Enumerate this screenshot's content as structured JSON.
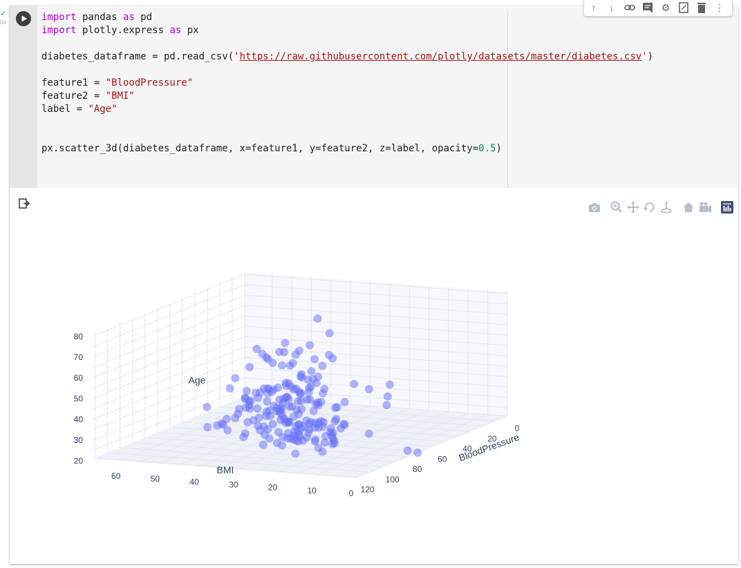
{
  "exec": {
    "check": "✓",
    "time": "0s"
  },
  "toolbar": {
    "icons": [
      "arrow-up-icon",
      "arrow-down-icon",
      "link-icon",
      "comment-icon",
      "gear-icon",
      "mirror-icon",
      "trash-icon",
      "more-icon"
    ]
  },
  "code": {
    "l1": {
      "kw": "import",
      "text": " pandas ",
      "kw2": "as",
      "text2": " pd"
    },
    "l2": {
      "kw": "import",
      "text": " plotly.express ",
      "kw2": "as",
      "text2": " px"
    },
    "l4": {
      "a": "diabetes_dataframe = pd.read_csv(",
      "q1": "'",
      "url": "https://raw.githubusercontent.com/plotly/datasets/master/diabetes.csv",
      "q2": "'",
      "b": ")"
    },
    "l6": {
      "a": "feature1 = ",
      "s": "\"BloodPressure\""
    },
    "l7": {
      "a": "feature2 = ",
      "s": "\"BMI\""
    },
    "l8": {
      "a": "label = ",
      "s": "\"Age\""
    },
    "l11": {
      "a": "px.scatter_3d(diabetes_dataframe, x=feature1, y=feature2, z=label, opacity=",
      "n": "0.5",
      "b": ")"
    }
  },
  "chart_data": {
    "type": "scatter",
    "projection": "3d",
    "marker_color": "#636efa",
    "opacity": 0.5,
    "axes": {
      "x": {
        "title": "BloodPressure",
        "ticks": [
          "0",
          "20",
          "40",
          "60",
          "80",
          "100",
          "120"
        ],
        "range": [
          0,
          122
        ]
      },
      "y": {
        "title": "BMI",
        "ticks": [
          "0",
          "10",
          "20",
          "30",
          "40",
          "50",
          "60"
        ],
        "range": [
          0,
          67
        ]
      },
      "z": {
        "title": "Age",
        "ticks": [
          "20",
          "30",
          "40",
          "50",
          "60",
          "70",
          "80"
        ],
        "range": [
          21,
          81
        ]
      }
    },
    "points": [
      [
        72,
        33.6,
        50
      ],
      [
        66,
        26.6,
        31
      ],
      [
        64,
        23.3,
        32
      ],
      [
        66,
        28.1,
        21
      ],
      [
        40,
        43.1,
        33
      ],
      [
        74,
        25.6,
        30
      ],
      [
        50,
        31,
        26
      ],
      [
        0,
        35.3,
        29
      ],
      [
        70,
        30.5,
        53
      ],
      [
        96,
        0,
        54
      ],
      [
        92,
        37.6,
        30
      ],
      [
        74,
        38,
        34
      ],
      [
        80,
        27.1,
        57
      ],
      [
        60,
        30.1,
        59
      ],
      [
        72,
        25.8,
        51
      ],
      [
        0,
        30,
        32
      ],
      [
        84,
        45.8,
        31
      ],
      [
        74,
        29.6,
        31
      ],
      [
        30,
        43.3,
        33
      ],
      [
        70,
        34.6,
        32
      ],
      [
        88,
        39.3,
        27
      ],
      [
        84,
        35.4,
        50
      ],
      [
        90,
        39.8,
        41
      ],
      [
        80,
        29,
        29
      ],
      [
        94,
        36.6,
        51
      ],
      [
        70,
        31.1,
        41
      ],
      [
        76,
        39.4,
        43
      ],
      [
        66,
        23.2,
        22
      ],
      [
        82,
        22.2,
        57
      ],
      [
        92,
        34.1,
        38
      ],
      [
        75,
        36,
        60
      ],
      [
        58,
        31.6,
        28
      ],
      [
        92,
        24.8,
        22
      ],
      [
        78,
        19.9,
        28
      ],
      [
        60,
        27.6,
        45
      ],
      [
        76,
        24,
        33
      ],
      [
        76,
        33.2,
        35
      ],
      [
        68,
        32.9,
        46
      ],
      [
        72,
        38.2,
        27
      ],
      [
        64,
        37.1,
        56
      ],
      [
        84,
        34,
        26
      ],
      [
        92,
        40.2,
        37
      ],
      [
        110,
        22.7,
        48
      ],
      [
        64,
        45.4,
        54
      ],
      [
        66,
        27.4,
        40
      ],
      [
        56,
        42,
        25
      ],
      [
        70,
        29.7,
        29
      ],
      [
        66,
        28,
        22
      ],
      [
        0,
        39.1,
        31
      ],
      [
        80,
        0,
        24
      ],
      [
        50,
        19.4,
        22
      ],
      [
        66,
        24.2,
        26
      ],
      [
        90,
        24.4,
        30
      ],
      [
        66,
        33.7,
        58
      ],
      [
        50,
        34.7,
        42
      ],
      [
        68,
        23,
        21
      ],
      [
        88,
        37.7,
        41
      ],
      [
        82,
        46.8,
        31
      ],
      [
        64,
        40.5,
        44
      ],
      [
        0,
        41.5,
        22
      ],
      [
        72,
        0,
        21
      ],
      [
        62,
        32.9,
        39
      ],
      [
        58,
        25,
        36
      ],
      [
        66,
        25.4,
        24
      ],
      [
        84,
        32.8,
        42
      ],
      [
        70,
        29,
        32
      ],
      [
        88,
        32.5,
        38
      ],
      [
        84,
        42.7,
        54
      ],
      [
        90,
        19.6,
        25
      ],
      [
        80,
        28.9,
        27
      ],
      [
        64,
        32.9,
        28
      ],
      [
        58,
        28.6,
        26
      ],
      [
        74,
        43.4,
        42
      ],
      [
        58,
        35.1,
        23
      ],
      [
        80,
        32,
        22
      ],
      [
        74,
        24.7,
        41
      ],
      [
        58,
        32.1,
        27
      ],
      [
        60,
        34.9,
        26
      ],
      [
        78,
        28.5,
        24
      ],
      [
        0,
        30.8,
        22
      ],
      [
        62,
        32.8,
        35
      ],
      [
        82,
        39.4,
        43
      ],
      [
        72,
        19.6,
        30
      ],
      [
        62,
        24.8,
        22
      ],
      [
        70,
        36.5,
        37
      ],
      [
        90,
        38.2,
        46
      ],
      [
        84,
        28.6,
        27
      ],
      [
        72,
        35.5,
        26
      ],
      [
        88,
        42.8,
        50
      ],
      [
        104,
        33.6,
        46
      ],
      [
        64,
        43.3,
        26
      ],
      [
        74,
        35,
        48
      ],
      [
        64,
        39.3,
        44
      ],
      [
        68,
        38.5,
        44
      ],
      [
        76,
        52.3,
        27
      ],
      [
        54,
        26.8,
        28
      ],
      [
        70,
        34.2,
        48
      ],
      [
        76,
        40.6,
        32
      ],
      [
        86,
        46.7,
        31
      ],
      [
        68,
        40.5,
        27
      ],
      [
        70,
        41.5,
        36
      ],
      [
        106,
        30.5,
        54
      ],
      [
        100,
        24,
        58
      ],
      [
        78,
        38.3,
        28
      ],
      [
        56,
        36.1,
        43
      ],
      [
        60,
        30.9,
        53
      ],
      [
        62,
        46.2,
        37
      ],
      [
        78,
        37.1,
        26
      ],
      [
        88,
        29.9,
        40
      ],
      [
        70,
        26.8,
        31
      ],
      [
        58,
        42.2,
        32
      ],
      [
        122,
        32.8,
        45
      ],
      [
        76,
        36.9,
        62
      ],
      [
        74,
        45.2,
        34
      ],
      [
        68,
        20.1,
        31
      ],
      [
        68,
        40.9,
        62
      ],
      [
        70,
        21.8,
        22
      ],
      [
        52,
        32.3,
        35
      ],
      [
        54,
        29.9,
        41
      ],
      [
        72,
        35.9,
        36
      ],
      [
        64,
        43.6,
        63
      ],
      [
        80,
        30.5,
        28
      ],
      [
        88,
        35.1,
        49
      ],
      [
        108,
        42.3,
        46
      ],
      [
        90,
        28.7,
        29
      ],
      [
        76,
        26.2,
        44
      ],
      [
        66,
        30.1,
        41
      ],
      [
        68,
        34.3,
        30
      ],
      [
        78,
        32.4,
        42
      ],
      [
        80,
        33.3,
        23
      ],
      [
        68,
        26.8,
        81
      ],
      [
        62,
        21.8,
        29
      ],
      [
        70,
        24.3,
        22
      ],
      [
        82,
        45.3,
        28
      ],
      [
        64,
        30.3,
        44
      ],
      [
        88,
        33.3,
        45
      ],
      [
        90,
        23.5,
        28
      ],
      [
        76,
        41.7,
        39
      ],
      [
        78,
        32.3,
        44
      ],
      [
        62,
        30.4,
        46
      ],
      [
        86,
        27.2,
        38
      ],
      [
        80,
        31.1,
        33
      ],
      [
        74,
        25.9,
        38
      ],
      [
        60,
        28.1,
        56
      ],
      [
        64,
        34.8,
        46
      ],
      [
        60,
        25.4,
        24
      ],
      [
        64,
        35.8,
        41
      ],
      [
        68,
        39.5,
        43
      ],
      [
        80,
        40.8,
        32
      ],
      [
        70,
        30.4,
        45
      ],
      [
        74,
        27.6,
        25
      ],
      [
        76,
        29,
        27
      ],
      [
        94,
        31.6,
        68
      ],
      [
        66,
        34.7,
        37
      ],
      [
        80,
        32.7,
        67
      ],
      [
        72,
        30.2,
        66
      ],
      [
        56,
        27.2,
        25
      ],
      [
        62,
        38.1,
        29
      ],
      [
        78,
        31.2,
        25
      ],
      [
        66,
        29.7,
        25
      ],
      [
        78,
        31.9,
        71
      ],
      [
        70,
        25.9,
        29
      ],
      [
        64,
        30.2,
        26
      ],
      [
        76,
        33.5,
        39
      ],
      [
        82,
        30.3,
        46
      ],
      [
        66,
        22.9,
        38
      ],
      [
        80,
        35.7,
        49
      ],
      [
        72,
        31.7,
        23
      ],
      [
        74,
        32.3,
        32
      ],
      [
        66,
        28.6,
        51
      ],
      [
        60,
        39.1,
        33
      ],
      [
        86,
        28.4,
        35
      ],
      [
        90,
        28.3,
        70
      ],
      [
        84,
        28.7,
        62
      ],
      [
        74,
        29.7,
        36
      ],
      [
        68,
        31.6,
        45
      ],
      [
        60,
        25.5,
        60
      ],
      [
        64,
        33.4,
        35
      ],
      [
        90,
        29.5,
        47
      ],
      [
        70,
        30.3,
        28
      ],
      [
        88,
        34.3,
        24
      ],
      [
        72,
        22.6,
        65
      ],
      [
        78,
        27.6,
        55
      ],
      [
        62,
        34.3,
        61
      ],
      [
        72,
        24.6,
        42
      ],
      [
        64,
        30.5,
        50
      ],
      [
        72,
        27.5,
        69
      ],
      [
        82,
        21.1,
        21
      ],
      [
        76,
        30.8,
        40
      ],
      [
        74,
        37.9,
        36
      ],
      [
        70,
        31.6,
        22
      ],
      [
        60,
        26.3,
        72
      ]
    ]
  }
}
